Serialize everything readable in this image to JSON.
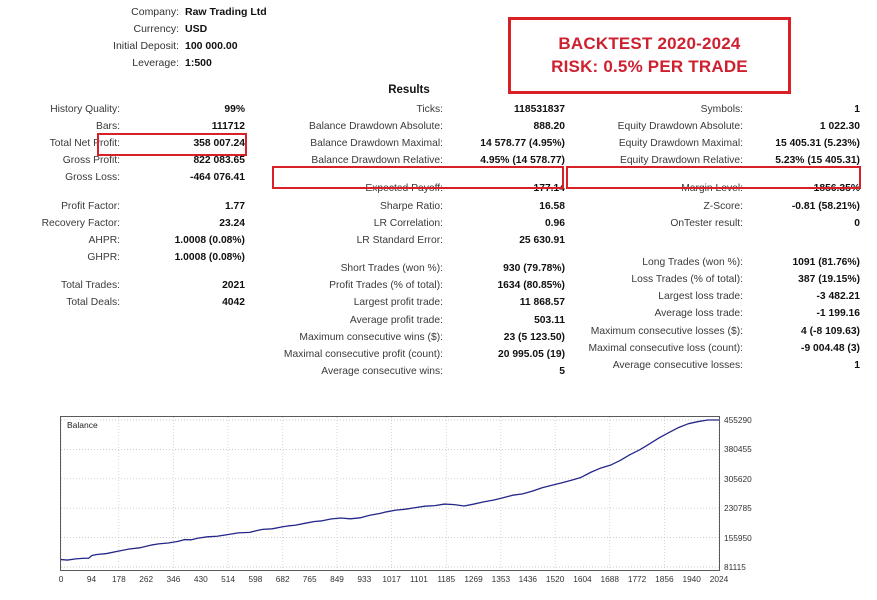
{
  "account": {
    "rows": [
      {
        "label": "Company:",
        "value": "Raw Trading Ltd"
      },
      {
        "label": "Currency:",
        "value": "USD"
      },
      {
        "label": "Initial Deposit:",
        "value": "100 000.00"
      },
      {
        "label": "Leverage:",
        "value": "1:500"
      }
    ]
  },
  "callout": {
    "line1": "BACKTEST 2020-2024",
    "line2": "RISK: 0.5% PER TRADE",
    "color": "#cf2030",
    "border_color": "#d92027"
  },
  "results": {
    "title": "Results",
    "highlight_color": "#d92027",
    "left_column": [
      {
        "label": "History Quality:",
        "value": "99%"
      },
      {
        "label": "Bars:",
        "value": "111712"
      },
      {
        "label": "Total Net Profit:",
        "value": "358 007.24"
      },
      {
        "label": "Gross Profit:",
        "value": "822 083.65"
      },
      {
        "label": "Gross Loss:",
        "value": "-464 076.41"
      },
      {
        "label": "Profit Factor:",
        "value": "1.77"
      },
      {
        "label": "Recovery Factor:",
        "value": "23.24"
      },
      {
        "label": "AHPR:",
        "value": "1.0008 (0.08%)"
      },
      {
        "label": "GHPR:",
        "value": "1.0008 (0.08%)"
      },
      {
        "label": "Total Trades:",
        "value": "2021"
      },
      {
        "label": "Total Deals:",
        "value": "4042"
      }
    ],
    "middle_column": [
      {
        "label": "Ticks:",
        "value": "118531837"
      },
      {
        "label": "Balance Drawdown Absolute:",
        "value": "888.20"
      },
      {
        "label": "Balance Drawdown Maximal:",
        "value": "14 578.77 (4.95%)"
      },
      {
        "label": "Balance Drawdown Relative:",
        "value": "4.95% (14 578.77)"
      },
      {
        "label": "Expected Payoff:",
        "value": "177.14"
      },
      {
        "label": "Sharpe Ratio:",
        "value": "16.58"
      },
      {
        "label": "LR Correlation:",
        "value": "0.96"
      },
      {
        "label": "LR Standard Error:",
        "value": "25 630.91"
      },
      {
        "label": "Short Trades (won %):",
        "value": "930 (79.78%)"
      },
      {
        "label": "Profit Trades (% of total):",
        "value": "1634 (80.85%)"
      },
      {
        "label": "Largest profit trade:",
        "value": "11 868.57"
      },
      {
        "label": "Average profit trade:",
        "value": "503.11"
      },
      {
        "label": "Maximum consecutive wins ($):",
        "value": "23 (5 123.50)"
      },
      {
        "label": "Maximal consecutive profit (count):",
        "value": "20 995.05 (19)"
      },
      {
        "label": "Average consecutive wins:",
        "value": "5"
      }
    ],
    "right_column": [
      {
        "label": "Symbols:",
        "value": "1"
      },
      {
        "label": "Equity Drawdown Absolute:",
        "value": "1 022.30"
      },
      {
        "label": "Equity Drawdown Maximal:",
        "value": "15 405.31 (5.23%)"
      },
      {
        "label": "Equity Drawdown Relative:",
        "value": "5.23% (15 405.31)"
      },
      {
        "label": "Margin Level:",
        "value": "1856.35%"
      },
      {
        "label": "Z-Score:",
        "value": "-0.81 (58.21%)"
      },
      {
        "label": "OnTester result:",
        "value": "0"
      },
      {
        "label": "Long Trades (won %):",
        "value": "1091 (81.76%)"
      },
      {
        "label": "Loss Trades (% of total):",
        "value": "387 (19.15%)"
      },
      {
        "label": "Largest loss trade:",
        "value": "-3 482.21"
      },
      {
        "label": "Average loss trade:",
        "value": "-1 199.16"
      },
      {
        "label": "Maximum consecutive losses ($):",
        "value": "4 (-8 109.63)"
      },
      {
        "label": "Maximal consecutive loss (count):",
        "value": "-9 004.48 (3)"
      },
      {
        "label": "Average consecutive losses:",
        "value": "1"
      }
    ]
  },
  "chart_data": {
    "type": "line",
    "title": "",
    "legend": [
      "Balance"
    ],
    "legend_position": "top-left",
    "grid": true,
    "line_color": "#232789",
    "xlabel": "",
    "ylabel": "",
    "xlim": [
      0,
      2024
    ],
    "ylim": [
      81115,
      455290
    ],
    "x_ticks": [
      0,
      94,
      178,
      262,
      346,
      430,
      514,
      598,
      682,
      765,
      849,
      933,
      1017,
      1101,
      1185,
      1269,
      1353,
      1436,
      1520,
      1604,
      1688,
      1772,
      1856,
      1940,
      2024
    ],
    "y_ticks": [
      81115,
      155950,
      230785,
      305620,
      380455,
      455290
    ],
    "series": [
      {
        "name": "Balance",
        "x": [
          0,
          20,
          45,
          70,
          85,
          95,
          110,
          140,
          175,
          210,
          245,
          280,
          300,
          330,
          360,
          380,
          400,
          420,
          450,
          480,
          510,
          545,
          580,
          600,
          620,
          650,
          680,
          700,
          720,
          750,
          780,
          800,
          830,
          860,
          890,
          920,
          950,
          980,
          1000,
          1030,
          1060,
          1090,
          1120,
          1150,
          1180,
          1210,
          1240,
          1270,
          1300,
          1330,
          1360,
          1390,
          1420,
          1450,
          1480,
          1510,
          1540,
          1570,
          1600,
          1630,
          1660,
          1690,
          1720,
          1750,
          1780,
          1810,
          1840,
          1870,
          1900,
          1930,
          1960,
          1990,
          2024
        ],
        "y": [
          100000,
          99500,
          101500,
          102500,
          104000,
          110000,
          112000,
          116000,
          121000,
          126000,
          131000,
          137000,
          139000,
          143000,
          146000,
          150000,
          151000,
          154000,
          157000,
          160000,
          163000,
          167000,
          170000,
          173000,
          176000,
          179000,
          183000,
          185000,
          188000,
          192000,
          196000,
          199000,
          203000,
          205000,
          204500,
          206000,
          212000,
          218000,
          221000,
          225000,
          229000,
          232000,
          235000,
          238000,
          241000,
          239000,
          237000,
          241000,
          246000,
          252000,
          257000,
          263000,
          268000,
          274000,
          282000,
          290000,
          295000,
          301000,
          310000,
          322000,
          332000,
          341000,
          352000,
          366000,
          380000,
          394000,
          409000,
          424000,
          436000,
          445000,
          452000,
          455000,
          455290
        ]
      }
    ]
  }
}
